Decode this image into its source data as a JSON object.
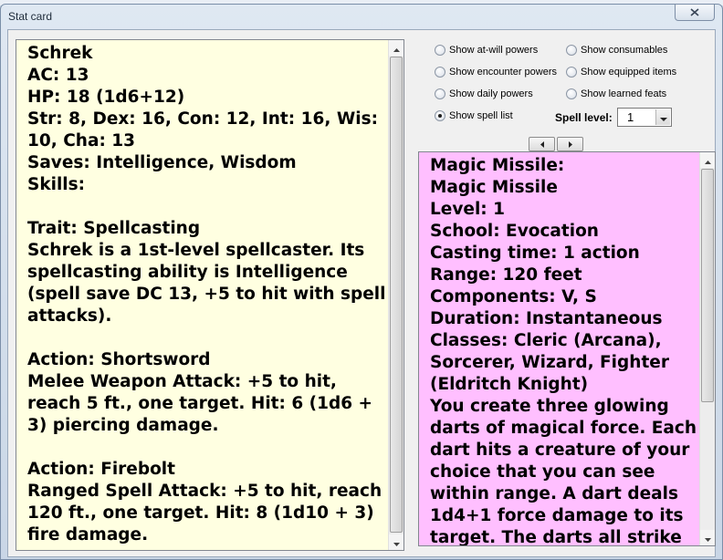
{
  "window": {
    "title": "Stat card"
  },
  "stat_text": "Schrek\nAC: 13\nHP: 18 (1d6+12)\nStr: 8, Dex: 16, Con: 12, Int: 16, Wis: 10, Cha: 13\nSaves: Intelligence, Wisdom\nSkills:\n\nTrait: Spellcasting\nSchrek is a 1st-level spellcaster. Its spellcasting ability is Intelligence (spell save DC 13, +5 to hit with spell attacks).\n\nAction: Shortsword\nMelee Weapon Attack: +5 to hit, reach 5 ft., one target. Hit: 6 (1d6 + 3) piercing damage.\n\nAction: Firebolt\nRanged Spell Attack: +5 to hit, reach 120 ft., one target. Hit: 8 (1d10 + 3) fire damage.",
  "options": {
    "at_will": {
      "label": "Show at-will powers",
      "checked": false
    },
    "encounter": {
      "label": "Show encounter powers",
      "checked": false
    },
    "daily": {
      "label": "Show daily powers",
      "checked": false
    },
    "spell_list": {
      "label": "Show spell list",
      "checked": true
    },
    "consumables": {
      "label": "Show consumables",
      "checked": false
    },
    "equipped": {
      "label": "Show equipped items",
      "checked": false
    },
    "feats": {
      "label": "Show learned feats",
      "checked": false
    }
  },
  "spell_level": {
    "label": "Spell level:",
    "value": "1"
  },
  "spell_text": "Magic Missile:\nMagic Missile\nLevel: 1\nSchool: Evocation\nCasting time: 1 action\nRange: 120 feet\nComponents: V, S\nDuration: Instantaneous\nClasses: Cleric (Arcana), Sorcerer, Wizard, Fighter (Eldritch Knight)\nYou create three glowing darts of magical force. Each dart hits a creature of your choice that you can see within range. A dart deals 1d4+1 force damage to its target. The darts all strike",
  "icons": {
    "close": "close-icon",
    "prev": "arrow-left-icon",
    "next": "arrow-right-icon",
    "dropdown": "chevron-down-icon"
  }
}
